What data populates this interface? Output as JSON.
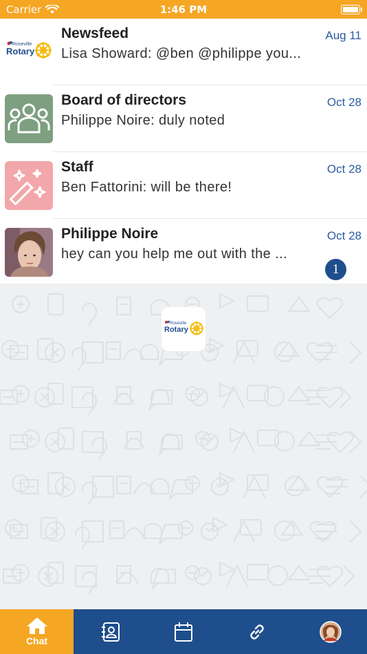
{
  "status_bar": {
    "carrier": "Carrier",
    "time": "1:46 PM"
  },
  "brand": {
    "logo_small": "Roseville",
    "logo_main": "Rotary",
    "color_orange": "#f5a623",
    "color_navy": "#1f4e8c"
  },
  "chats": [
    {
      "title": "Newsfeed",
      "preview": "Lisa Showard: @ben @philippe you...",
      "date": "Aug 11",
      "avatar": "rotary-logo"
    },
    {
      "title": "Board of directors",
      "preview": "Philippe Noire: duly noted",
      "date": "Oct 28",
      "avatar": "group-icon",
      "avatar_color": "#7e9f80"
    },
    {
      "title": "Staff",
      "preview": "Ben Fattorini: will be there!",
      "date": "Oct 28",
      "avatar": "magic-wand-icon",
      "avatar_color": "#f2a7aa"
    },
    {
      "title": "Philippe Noire",
      "preview": "hey can you help me out with the ...",
      "date": "Oct 28",
      "badge": "1",
      "avatar": "person-photo"
    }
  ],
  "tabs": [
    {
      "label": "Chat",
      "icon": "home-icon",
      "active": true
    },
    {
      "label": "",
      "icon": "contacts-icon"
    },
    {
      "label": "",
      "icon": "calendar-icon"
    },
    {
      "label": "",
      "icon": "link-icon"
    },
    {
      "label": "",
      "icon": "profile-avatar"
    }
  ]
}
